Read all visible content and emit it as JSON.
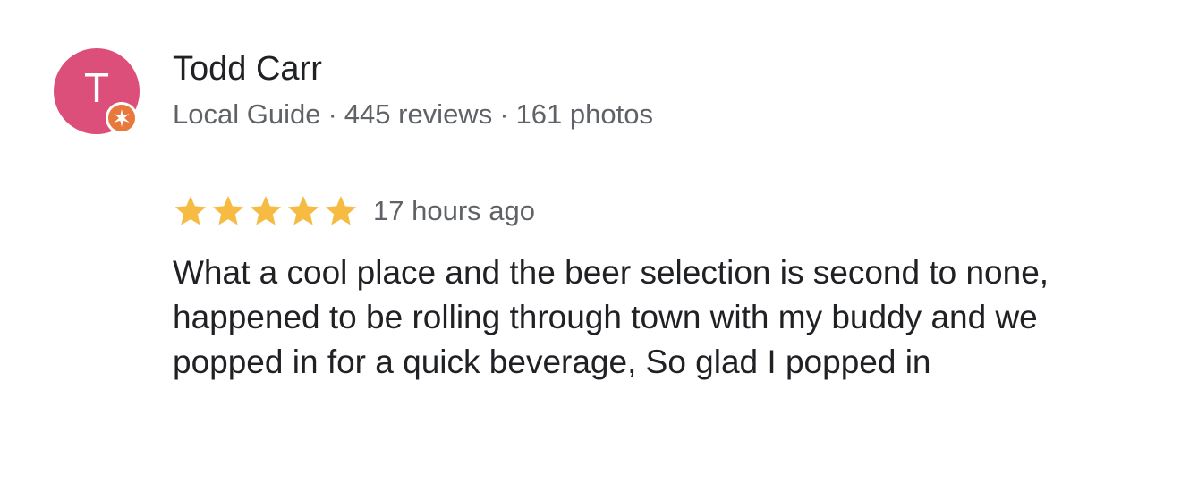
{
  "reviewer": {
    "avatar_initial": "T",
    "avatar_color": "#dc4f7b",
    "badge_color": "#e8793c",
    "badge_icon": "local-guide-star-icon",
    "name": "Todd Carr",
    "role": "Local Guide",
    "separator": "·",
    "reviews": "445 reviews",
    "photos": "161 photos"
  },
  "review": {
    "rating": 5,
    "max_rating": 5,
    "star_color": "#f6bb42",
    "time": "17 hours ago",
    "text": "What a cool place and the beer selection is second to none, happened to be rolling through town with my buddy and we popped in for a quick beverage, So glad I popped in"
  }
}
